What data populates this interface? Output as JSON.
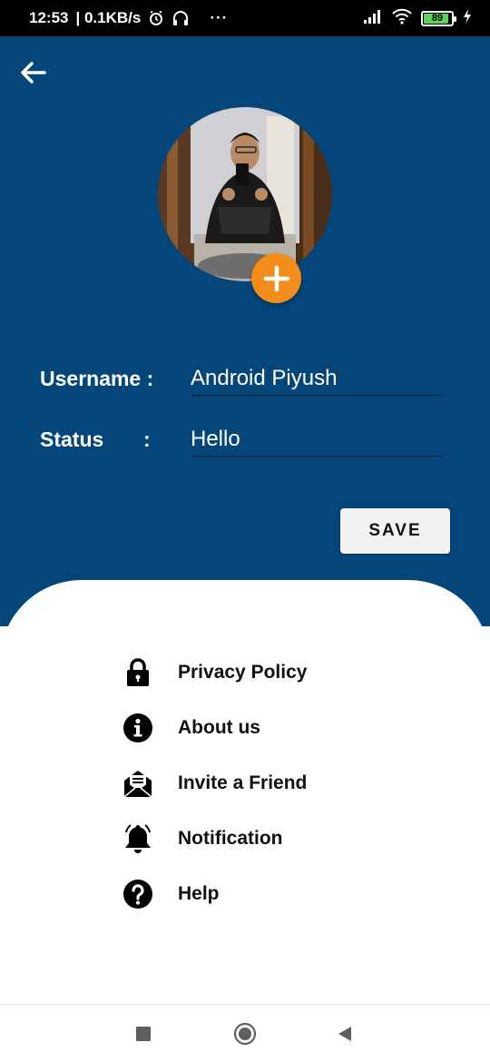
{
  "status_bar": {
    "time": "12:53",
    "speed": "| 0.1KB/s",
    "dots": "···",
    "battery_level": "89",
    "icons": [
      "alarm-icon",
      "headset-icon",
      "signal-icon",
      "wifi-icon",
      "battery-icon",
      "charging-icon"
    ]
  },
  "header": {
    "back_icon": "arrow-left-icon",
    "avatar_alt": "profile-photo",
    "add_icon": "plus-icon"
  },
  "form": {
    "username_label": "Username :",
    "username_value": "Android Piyush",
    "status_label": "Status",
    "status_colon": ":",
    "status_value": "Hello",
    "save_label": "SAVE"
  },
  "menu": {
    "items": [
      {
        "label": "Privacy Policy",
        "icon": "lock-icon"
      },
      {
        "label": "About us",
        "icon": "info-icon"
      },
      {
        "label": "Invite a Friend",
        "icon": "mail-open-icon"
      },
      {
        "label": "Notification",
        "icon": "bell-icon"
      },
      {
        "label": "Help",
        "icon": "help-icon"
      }
    ]
  },
  "nav_bar": {
    "icons": [
      "recents-icon",
      "home-icon",
      "back-triangle-icon"
    ]
  },
  "colors": {
    "header_bg": "#05467a",
    "accent_orange": "#f28c1a",
    "battery_green": "#5bd25b"
  }
}
